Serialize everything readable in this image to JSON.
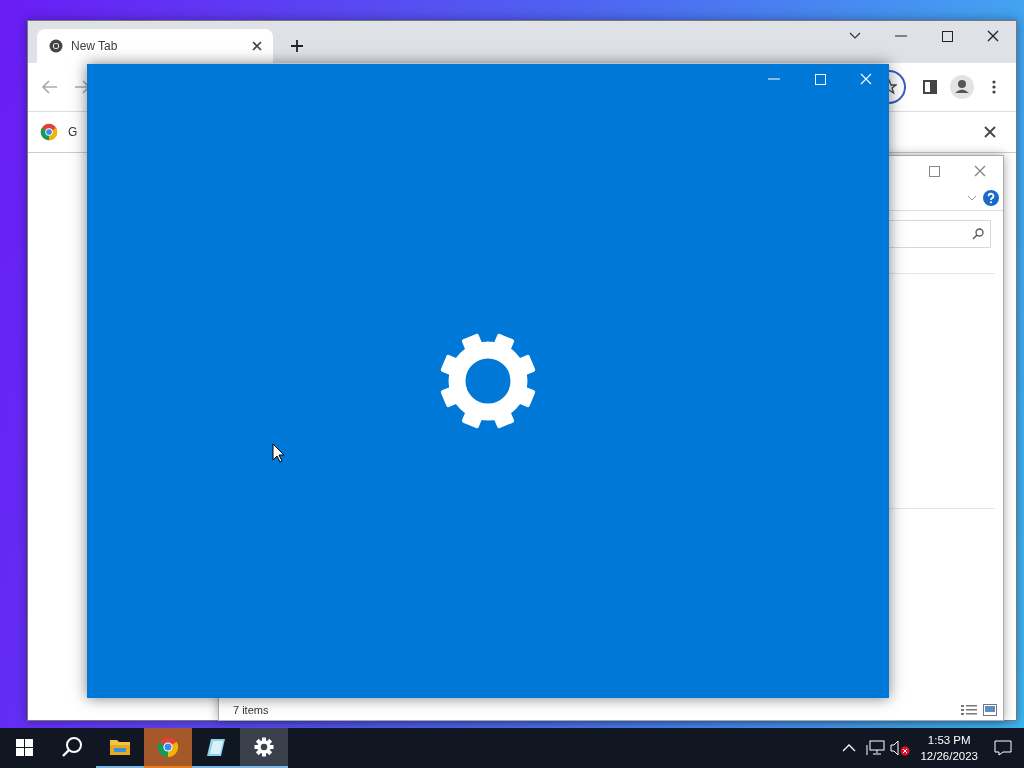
{
  "browser": {
    "tabs": [
      {
        "label": "New Tab",
        "selected": true
      }
    ],
    "bookmarks": [
      {
        "label": "G"
      }
    ]
  },
  "explorer": {
    "status_bar": {
      "item_count": "7 items"
    }
  },
  "settings_window": {
    "kind": "splash"
  },
  "taskbar": {
    "apps": [
      {
        "kind": "explorer",
        "running": true,
        "selected": false,
        "attention": false
      },
      {
        "kind": "chrome",
        "running": true,
        "selected": false,
        "attention": true
      },
      {
        "kind": "notepad",
        "running": true,
        "selected": false,
        "attention": false
      },
      {
        "kind": "settings",
        "running": true,
        "selected": true,
        "attention": false
      }
    ],
    "clock": {
      "time": "1:53 PM",
      "date": "12/26/2023"
    }
  }
}
